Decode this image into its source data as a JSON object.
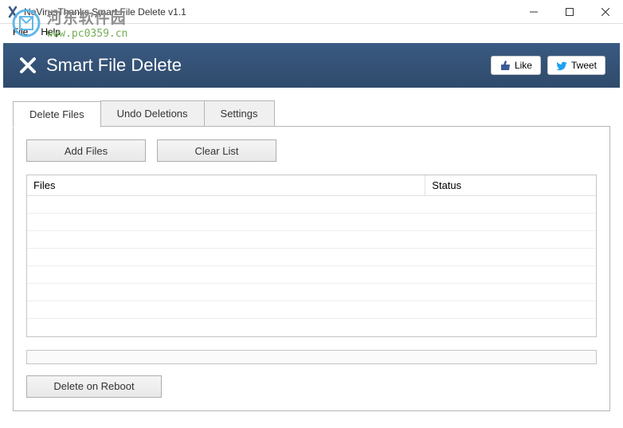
{
  "watermark": {
    "title": "河东软件园",
    "url": "www.pc0359.cn"
  },
  "titlebar": {
    "title": "NoVirusThanks Smart File Delete v1.1"
  },
  "menubar": {
    "file": "File",
    "help": "Help"
  },
  "header": {
    "title": "Smart File Delete",
    "like_label": "Like",
    "tweet_label": "Tweet"
  },
  "tabs": {
    "delete_files": "Delete Files",
    "undo_deletions": "Undo Deletions",
    "settings": "Settings"
  },
  "buttons": {
    "add_files": "Add Files",
    "clear_list": "Clear List",
    "delete_on_reboot": "Delete on Reboot"
  },
  "table": {
    "col_files": "Files",
    "col_status": "Status"
  }
}
